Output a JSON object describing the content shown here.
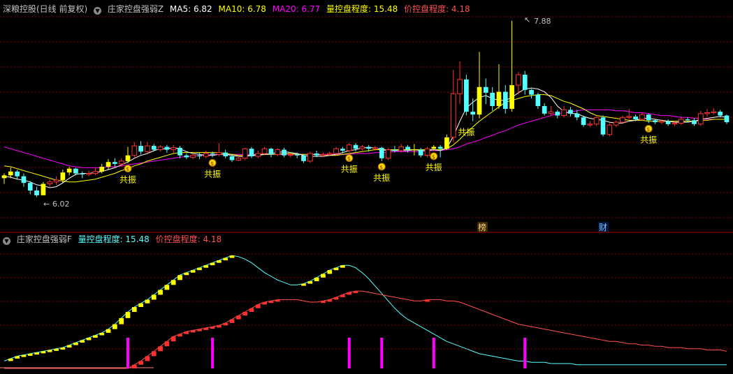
{
  "header_main": {
    "stock": "深粮控股(日线 前复权)",
    "indicator": "庄家控盘强弱Z",
    "ma5": "MA5: 6.82",
    "ma10": "MA10: 6.78",
    "ma20": "MA20: 6.77",
    "vol_ctrl": "量控盘程度: 15.48",
    "price_ctrl": "价控盘程度: 4.18"
  },
  "header_sub": {
    "indicator": "庄家控盘强弱F",
    "vol_ctrl": "量控盘程度: 15.48",
    "price_ctrl": "价控盘程度: 4.18"
  },
  "labels": {
    "high": "7.88",
    "low": "6.02",
    "resonance": "共振",
    "bang": "榜",
    "cai": "财",
    "money": "$"
  },
  "colors": {
    "up": "#ff3232",
    "down": "#54ffff",
    "yellow": "#ffff00",
    "ma5": "#ffffff",
    "ma10": "#ffff00",
    "ma20": "#ff00ff",
    "vol_ctrl": "#54ffff",
    "price_ctrl": "#ff5050",
    "grid": "#8b0000"
  },
  "chart_data": {
    "type": "candlestick",
    "price_range": [
      6.02,
      7.88
    ],
    "candles": [
      [
        6.22,
        6.25,
        6.16,
        6.27
      ],
      [
        6.25,
        6.29,
        6.22,
        6.33
      ],
      [
        6.29,
        6.24,
        6.21,
        6.31
      ],
      [
        6.24,
        6.17,
        6.13,
        6.27
      ],
      [
        6.17,
        6.09,
        6.05,
        6.19
      ],
      [
        6.09,
        6.04,
        6.02,
        6.13
      ],
      [
        6.04,
        6.16,
        6.04,
        6.18
      ],
      [
        6.16,
        6.18,
        6.13,
        6.21
      ],
      [
        6.18,
        6.2,
        6.15,
        6.24
      ],
      [
        6.2,
        6.28,
        6.17,
        6.31
      ],
      [
        6.28,
        6.32,
        6.25,
        6.34
      ],
      [
        6.32,
        6.27,
        6.25,
        6.33
      ],
      [
        6.27,
        6.26,
        6.22,
        6.29
      ],
      [
        6.26,
        6.27,
        6.24,
        6.3
      ],
      [
        6.27,
        6.29,
        6.25,
        6.33
      ],
      [
        6.29,
        6.34,
        6.27,
        6.37
      ],
      [
        6.34,
        6.39,
        6.31,
        6.42
      ],
      [
        6.39,
        6.37,
        6.34,
        6.43
      ],
      [
        6.37,
        6.4,
        6.34,
        6.43
      ],
      [
        6.4,
        6.46,
        6.38,
        6.55
      ],
      [
        6.46,
        6.56,
        6.43,
        6.6
      ],
      [
        6.56,
        6.5,
        6.47,
        6.61
      ],
      [
        6.5,
        6.56,
        6.48,
        6.6
      ],
      [
        6.56,
        6.52,
        6.5,
        6.58
      ],
      [
        6.52,
        6.55,
        6.5,
        6.57
      ],
      [
        6.55,
        6.52,
        6.49,
        6.57
      ],
      [
        6.52,
        6.54,
        6.48,
        6.57
      ],
      [
        6.54,
        6.46,
        6.43,
        6.56
      ],
      [
        6.46,
        6.44,
        6.42,
        6.48
      ],
      [
        6.44,
        6.46,
        6.42,
        6.48
      ],
      [
        6.46,
        6.45,
        6.42,
        6.49
      ],
      [
        6.45,
        6.48,
        6.43,
        6.51
      ],
      [
        6.48,
        6.47,
        6.44,
        6.5
      ],
      [
        6.47,
        6.49,
        6.45,
        6.59
      ],
      [
        6.49,
        6.45,
        6.43,
        6.52
      ],
      [
        6.45,
        6.41,
        6.39,
        6.47
      ],
      [
        6.41,
        6.43,
        6.4,
        6.46
      ],
      [
        6.43,
        6.53,
        6.41,
        6.54
      ],
      [
        6.53,
        6.45,
        6.43,
        6.55
      ],
      [
        6.45,
        6.48,
        6.43,
        6.51
      ],
      [
        6.48,
        6.53,
        6.46,
        6.55
      ],
      [
        6.53,
        6.47,
        6.44,
        6.54
      ],
      [
        6.47,
        6.52,
        6.45,
        6.54
      ],
      [
        6.52,
        6.46,
        6.44,
        6.54
      ],
      [
        6.46,
        6.47,
        6.44,
        6.49
      ],
      [
        6.47,
        6.46,
        6.43,
        6.49
      ],
      [
        6.46,
        6.4,
        6.38,
        6.47
      ],
      [
        6.4,
        6.48,
        6.38,
        6.5
      ],
      [
        6.48,
        6.46,
        6.44,
        6.51
      ],
      [
        6.46,
        6.47,
        6.44,
        6.49
      ],
      [
        6.47,
        6.48,
        6.45,
        6.5
      ],
      [
        6.48,
        6.53,
        6.46,
        6.55
      ],
      [
        6.53,
        6.51,
        6.48,
        6.55
      ],
      [
        6.51,
        6.57,
        6.49,
        6.59
      ],
      [
        6.57,
        6.53,
        6.5,
        6.59
      ],
      [
        6.53,
        6.55,
        6.51,
        6.57
      ],
      [
        6.55,
        6.53,
        6.5,
        6.57
      ],
      [
        6.53,
        6.54,
        6.51,
        6.56
      ],
      [
        6.54,
        6.43,
        6.4,
        6.55
      ],
      [
        6.43,
        6.52,
        6.41,
        6.54
      ],
      [
        6.52,
        6.51,
        6.49,
        6.56
      ],
      [
        6.51,
        6.55,
        6.49,
        6.58
      ],
      [
        6.55,
        6.52,
        6.49,
        6.57
      ],
      [
        6.52,
        6.52,
        6.46,
        6.58
      ],
      [
        6.52,
        6.46,
        6.44,
        6.54
      ],
      [
        6.46,
        6.53,
        6.44,
        6.55
      ],
      [
        6.53,
        6.55,
        6.51,
        6.57
      ],
      [
        6.55,
        6.53,
        6.44,
        6.57
      ],
      [
        6.53,
        6.65,
        6.52,
        6.68
      ],
      [
        6.65,
        7.11,
        6.6,
        7.36
      ],
      [
        7.11,
        7.26,
        7.0,
        7.45
      ],
      [
        7.26,
        6.92,
        6.88,
        7.31
      ],
      [
        6.92,
        6.89,
        6.82,
        7.06
      ],
      [
        6.89,
        7.18,
        6.85,
        7.55
      ],
      [
        7.18,
        7.12,
        7.0,
        7.27
      ],
      [
        7.12,
        6.98,
        6.93,
        7.18
      ],
      [
        6.98,
        7.13,
        6.95,
        7.42
      ],
      [
        7.13,
        6.95,
        6.9,
        7.2
      ],
      [
        6.95,
        7.2,
        6.92,
        7.88
      ],
      [
        7.2,
        7.31,
        7.1,
        7.34
      ],
      [
        7.31,
        7.15,
        7.1,
        7.35
      ],
      [
        7.15,
        7.1,
        7.06,
        7.16
      ],
      [
        7.1,
        6.98,
        6.95,
        7.12
      ],
      [
        6.98,
        6.9,
        6.88,
        7.01
      ],
      [
        6.9,
        6.92,
        6.88,
        6.98
      ],
      [
        6.92,
        6.88,
        6.85,
        6.94
      ],
      [
        6.88,
        6.94,
        6.86,
        6.98
      ],
      [
        6.94,
        6.9,
        6.87,
        6.97
      ],
      [
        6.9,
        6.86,
        6.83,
        6.94
      ],
      [
        6.86,
        6.78,
        6.76,
        6.88
      ],
      [
        6.78,
        6.79,
        6.76,
        6.82
      ],
      [
        6.79,
        6.86,
        6.77,
        6.88
      ],
      [
        6.86,
        6.68,
        6.66,
        6.88
      ],
      [
        6.68,
        6.78,
        6.66,
        6.8
      ],
      [
        6.78,
        6.81,
        6.76,
        6.83
      ],
      [
        6.81,
        6.86,
        6.79,
        6.88
      ],
      [
        6.86,
        6.87,
        6.84,
        6.95
      ],
      [
        6.87,
        6.84,
        6.82,
        6.89
      ],
      [
        6.84,
        6.89,
        6.82,
        6.91
      ],
      [
        6.89,
        6.83,
        6.8,
        6.9
      ],
      [
        6.83,
        6.81,
        6.79,
        6.84
      ],
      [
        6.81,
        6.82,
        6.79,
        6.84
      ],
      [
        6.82,
        6.79,
        6.77,
        6.84
      ],
      [
        6.79,
        6.8,
        6.77,
        6.82
      ],
      [
        6.8,
        6.84,
        6.78,
        6.86
      ],
      [
        6.84,
        6.83,
        6.81,
        6.86
      ],
      [
        6.83,
        6.79,
        6.77,
        6.85
      ],
      [
        6.79,
        6.9,
        6.77,
        6.93
      ],
      [
        6.9,
        6.91,
        6.87,
        6.95
      ],
      [
        6.91,
        6.92,
        6.89,
        6.96
      ],
      [
        6.92,
        6.88,
        6.86,
        6.94
      ],
      [
        6.88,
        6.81,
        6.79,
        6.89
      ]
    ],
    "candle_style_yellow_up": [
      0,
      1,
      6,
      9,
      10,
      15,
      16,
      19,
      21,
      23,
      63,
      66,
      68,
      73,
      74,
      76,
      78
    ],
    "ma5": [
      6.24,
      6.23,
      6.21,
      6.2,
      6.18,
      6.15,
      6.14,
      6.12,
      6.13,
      6.17,
      6.22,
      6.26,
      6.27,
      6.27,
      6.28,
      6.29,
      6.31,
      6.33,
      6.36,
      6.39,
      6.43,
      6.46,
      6.48,
      6.51,
      6.53,
      6.53,
      6.54,
      6.53,
      6.5,
      6.48,
      6.47,
      6.46,
      6.46,
      6.47,
      6.47,
      6.46,
      6.45,
      6.45,
      6.46,
      6.46,
      6.47,
      6.48,
      6.49,
      6.5,
      6.49,
      6.48,
      6.46,
      6.45,
      6.45,
      6.45,
      6.46,
      6.47,
      6.49,
      6.51,
      6.52,
      6.54,
      6.54,
      6.54,
      6.52,
      6.51,
      6.51,
      6.51,
      6.51,
      6.52,
      6.51,
      6.51,
      6.52,
      6.51,
      6.54,
      6.66,
      6.82,
      6.96,
      7.02,
      7.07,
      7.09,
      7.06,
      7.04,
      7.04,
      7.07,
      7.12,
      7.16,
      7.17,
      7.16,
      7.13,
      7.07,
      6.98,
      6.92,
      6.9,
      6.9,
      6.87,
      6.85,
      6.84,
      6.83,
      6.81,
      6.8,
      6.8,
      6.82,
      6.83,
      6.85,
      6.85,
      6.84,
      6.83,
      6.82,
      6.81,
      6.81,
      6.81,
      6.82,
      6.84,
      6.85,
      6.86,
      6.87,
      6.86
    ],
    "ma10": [
      6.35,
      6.34,
      6.32,
      6.3,
      6.28,
      6.26,
      6.24,
      6.22,
      6.2,
      6.19,
      6.18,
      6.18,
      6.19,
      6.2,
      6.21,
      6.23,
      6.25,
      6.27,
      6.3,
      6.32,
      6.35,
      6.37,
      6.4,
      6.42,
      6.44,
      6.46,
      6.48,
      6.49,
      6.49,
      6.49,
      6.49,
      6.49,
      6.49,
      6.49,
      6.48,
      6.47,
      6.46,
      6.46,
      6.46,
      6.47,
      6.47,
      6.47,
      6.47,
      6.48,
      6.48,
      6.47,
      6.47,
      6.47,
      6.47,
      6.46,
      6.46,
      6.46,
      6.47,
      6.48,
      6.49,
      6.5,
      6.51,
      6.52,
      6.52,
      6.52,
      6.52,
      6.52,
      6.52,
      6.52,
      6.52,
      6.52,
      6.52,
      6.52,
      6.53,
      6.57,
      6.63,
      6.7,
      6.76,
      6.82,
      6.87,
      6.92,
      6.97,
      7.02,
      7.04,
      7.06,
      7.08,
      7.09,
      7.1,
      7.1,
      7.09,
      7.06,
      7.03,
      7.01,
      6.98,
      6.95,
      6.91,
      6.88,
      6.87,
      6.86,
      6.85,
      6.84,
      6.83,
      6.83,
      6.83,
      6.82,
      6.82,
      6.82,
      6.82,
      6.82,
      6.82,
      6.82,
      6.82,
      6.83,
      6.83,
      6.84,
      6.84,
      6.84
    ],
    "ma20": [
      6.55,
      6.53,
      6.51,
      6.49,
      6.47,
      6.45,
      6.43,
      6.41,
      6.39,
      6.37,
      6.35,
      6.34,
      6.33,
      6.33,
      6.33,
      6.33,
      6.34,
      6.34,
      6.35,
      6.36,
      6.37,
      6.38,
      6.39,
      6.4,
      6.41,
      6.42,
      6.43,
      6.44,
      6.45,
      6.45,
      6.46,
      6.46,
      6.47,
      6.47,
      6.47,
      6.47,
      6.47,
      6.47,
      6.47,
      6.47,
      6.47,
      6.47,
      6.47,
      6.47,
      6.47,
      6.47,
      6.47,
      6.47,
      6.47,
      6.47,
      6.47,
      6.47,
      6.47,
      6.47,
      6.48,
      6.48,
      6.48,
      6.49,
      6.49,
      6.49,
      6.5,
      6.5,
      6.5,
      6.5,
      6.5,
      6.51,
      6.51,
      6.51,
      6.52,
      6.53,
      6.55,
      6.58,
      6.6,
      6.62,
      6.65,
      6.67,
      6.7,
      6.72,
      6.75,
      6.78,
      6.8,
      6.82,
      6.84,
      6.86,
      6.88,
      6.9,
      6.91,
      6.92,
      6.93,
      6.94,
      6.94,
      6.94,
      6.94,
      6.94,
      6.93,
      6.93,
      6.92,
      6.91,
      6.91,
      6.9,
      6.89,
      6.88,
      6.88,
      6.87,
      6.86,
      6.86,
      6.85,
      6.85,
      6.84,
      6.84,
      6.84,
      6.84
    ],
    "resonance_markers": [
      19,
      32,
      53,
      58,
      66,
      71,
      99
    ],
    "money_markers": [
      19,
      32,
      53,
      58,
      66,
      99
    ],
    "indicator_range": [
      0,
      100
    ],
    "vol_ctrl": [
      6,
      8,
      10,
      11,
      12,
      13,
      14,
      15,
      16,
      17,
      19,
      21,
      23,
      25,
      27,
      29,
      32,
      36,
      41,
      46,
      50,
      53,
      56,
      60,
      64,
      68,
      72,
      76,
      78,
      80,
      82,
      84,
      86,
      88,
      90,
      92,
      91,
      89,
      86,
      82,
      78,
      75,
      72,
      70,
      68,
      68,
      69,
      71,
      74,
      77,
      80,
      82,
      84,
      84,
      82,
      78,
      73,
      67,
      61,
      55,
      49,
      44,
      40,
      37,
      34,
      31,
      28,
      25,
      22,
      20,
      18,
      16,
      14,
      12,
      11,
      10,
      9,
      8,
      7,
      6,
      6,
      5,
      5,
      5,
      4,
      4,
      4,
      4,
      3,
      3,
      3,
      3,
      3,
      3,
      3,
      3,
      3,
      3,
      3,
      3,
      3,
      3,
      3,
      3,
      3,
      3,
      3,
      3,
      3,
      3,
      3,
      3
    ],
    "price_ctrl": [
      0,
      0,
      0,
      0,
      0,
      0,
      0,
      0,
      0,
      0,
      0,
      0,
      0,
      0,
      0,
      0,
      0,
      0,
      0,
      0,
      3,
      6,
      10,
      14,
      18,
      22,
      26,
      28,
      30,
      31,
      32,
      33,
      34,
      35,
      37,
      40,
      43,
      46,
      49,
      52,
      54,
      55,
      56,
      56,
      56,
      56,
      55,
      54,
      54,
      55,
      56,
      58,
      60,
      62,
      63,
      63,
      62,
      61,
      60,
      59,
      58,
      57,
      56,
      55,
      55,
      56,
      56,
      56,
      55,
      55,
      54,
      52,
      50,
      48,
      46,
      44,
      42,
      40,
      38,
      36,
      35,
      34,
      33,
      32,
      31,
      30,
      29,
      28,
      27,
      26,
      25,
      24,
      23,
      22,
      22,
      21,
      20,
      20,
      19,
      19,
      18,
      18,
      17,
      17,
      17,
      16,
      16,
      16,
      15,
      15,
      15,
      14
    ],
    "magenta_bars": [
      19,
      32,
      53,
      58,
      66,
      80
    ]
  }
}
